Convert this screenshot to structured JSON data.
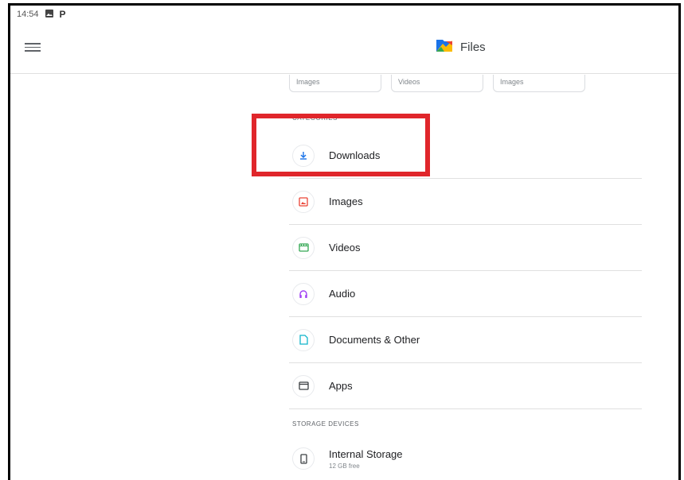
{
  "status_bar": {
    "time": "14:54",
    "icons": [
      "image-icon",
      "parking-icon"
    ]
  },
  "app_bar": {
    "title": "Files",
    "menu_icon": "hamburger-menu-icon"
  },
  "recent": {
    "cards": [
      "Images",
      "Videos",
      "Images"
    ]
  },
  "categories": {
    "heading": "CATEGORIES",
    "items": [
      {
        "label": "Downloads",
        "icon": "download-icon",
        "color": "#1a73e8"
      },
      {
        "label": "Images",
        "icon": "image-icon",
        "color": "#ea4335"
      },
      {
        "label": "Videos",
        "icon": "video-icon",
        "color": "#34a853"
      },
      {
        "label": "Audio",
        "icon": "headphones-icon",
        "color": "#a142f4"
      },
      {
        "label": "Documents & Other",
        "icon": "document-icon",
        "color": "#12b5cb"
      },
      {
        "label": "Apps",
        "icon": "apps-icon",
        "color": "#3c4043"
      }
    ]
  },
  "storage": {
    "heading": "STORAGE DEVICES",
    "items": [
      {
        "label": "Internal Storage",
        "sublabel": "12 GB free",
        "icon": "phone-icon"
      }
    ]
  },
  "annotation": {
    "highlight_color": "#e0262b"
  }
}
